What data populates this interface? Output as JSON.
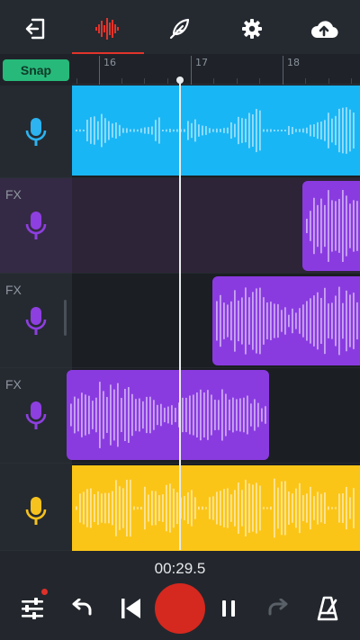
{
  "toolbar": {
    "icons": [
      "exit-icon",
      "waveform-icon",
      "feather-icon",
      "gear-icon",
      "cloud-upload-icon"
    ],
    "active_tab": "waveform",
    "accent_color": "#e2342b"
  },
  "snap": {
    "label": "Snap",
    "color": "#27b97a"
  },
  "ruler": {
    "markers": [
      "16",
      "17",
      "18"
    ]
  },
  "tracks": [
    {
      "fx_label": "",
      "mic_color": "#2cb3f0",
      "clip_color": "#19b6f5"
    },
    {
      "fx_label": "FX",
      "mic_color": "#8e3fe0",
      "clip_color": "#8a3be0",
      "selected": true
    },
    {
      "fx_label": "FX",
      "mic_color": "#8e3fe0",
      "clip_color": "#8a3be0"
    },
    {
      "fx_label": "FX",
      "mic_color": "#8e3fe0",
      "clip_color": "#8a3be0"
    },
    {
      "fx_label": "",
      "mic_color": "#f6c21d",
      "clip_color": "#fbc518"
    }
  ],
  "transport": {
    "time": "00:29.5",
    "icons": [
      "mixer-sliders-icon",
      "undo-icon",
      "skip-to-start-icon",
      "record-button",
      "pause-icon",
      "redo-icon",
      "metronome-icon"
    ],
    "record_color": "#d5281f"
  }
}
